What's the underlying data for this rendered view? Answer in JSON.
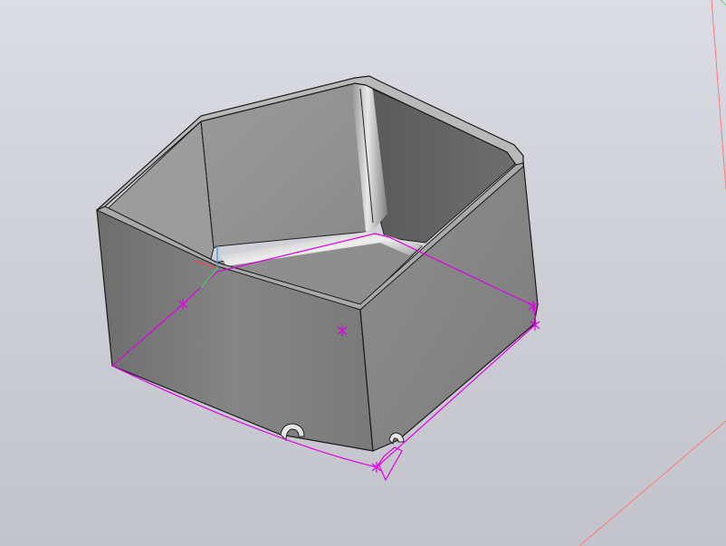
{
  "viewport": {
    "background_top": "#dcdde4",
    "background_bottom": "#c3c4cb"
  },
  "model": {
    "part": "pentagonal-box-shell",
    "body_color": "#8a8a8a",
    "edge_color": "#1a1a1a",
    "sketch_color": "#e100e6"
  },
  "triad": {
    "x_axis_color": "#e05050",
    "y_axis_color": "#50c850",
    "z_axis_color": "#3aa0e6"
  },
  "reference_lines_color": "#ff6464"
}
